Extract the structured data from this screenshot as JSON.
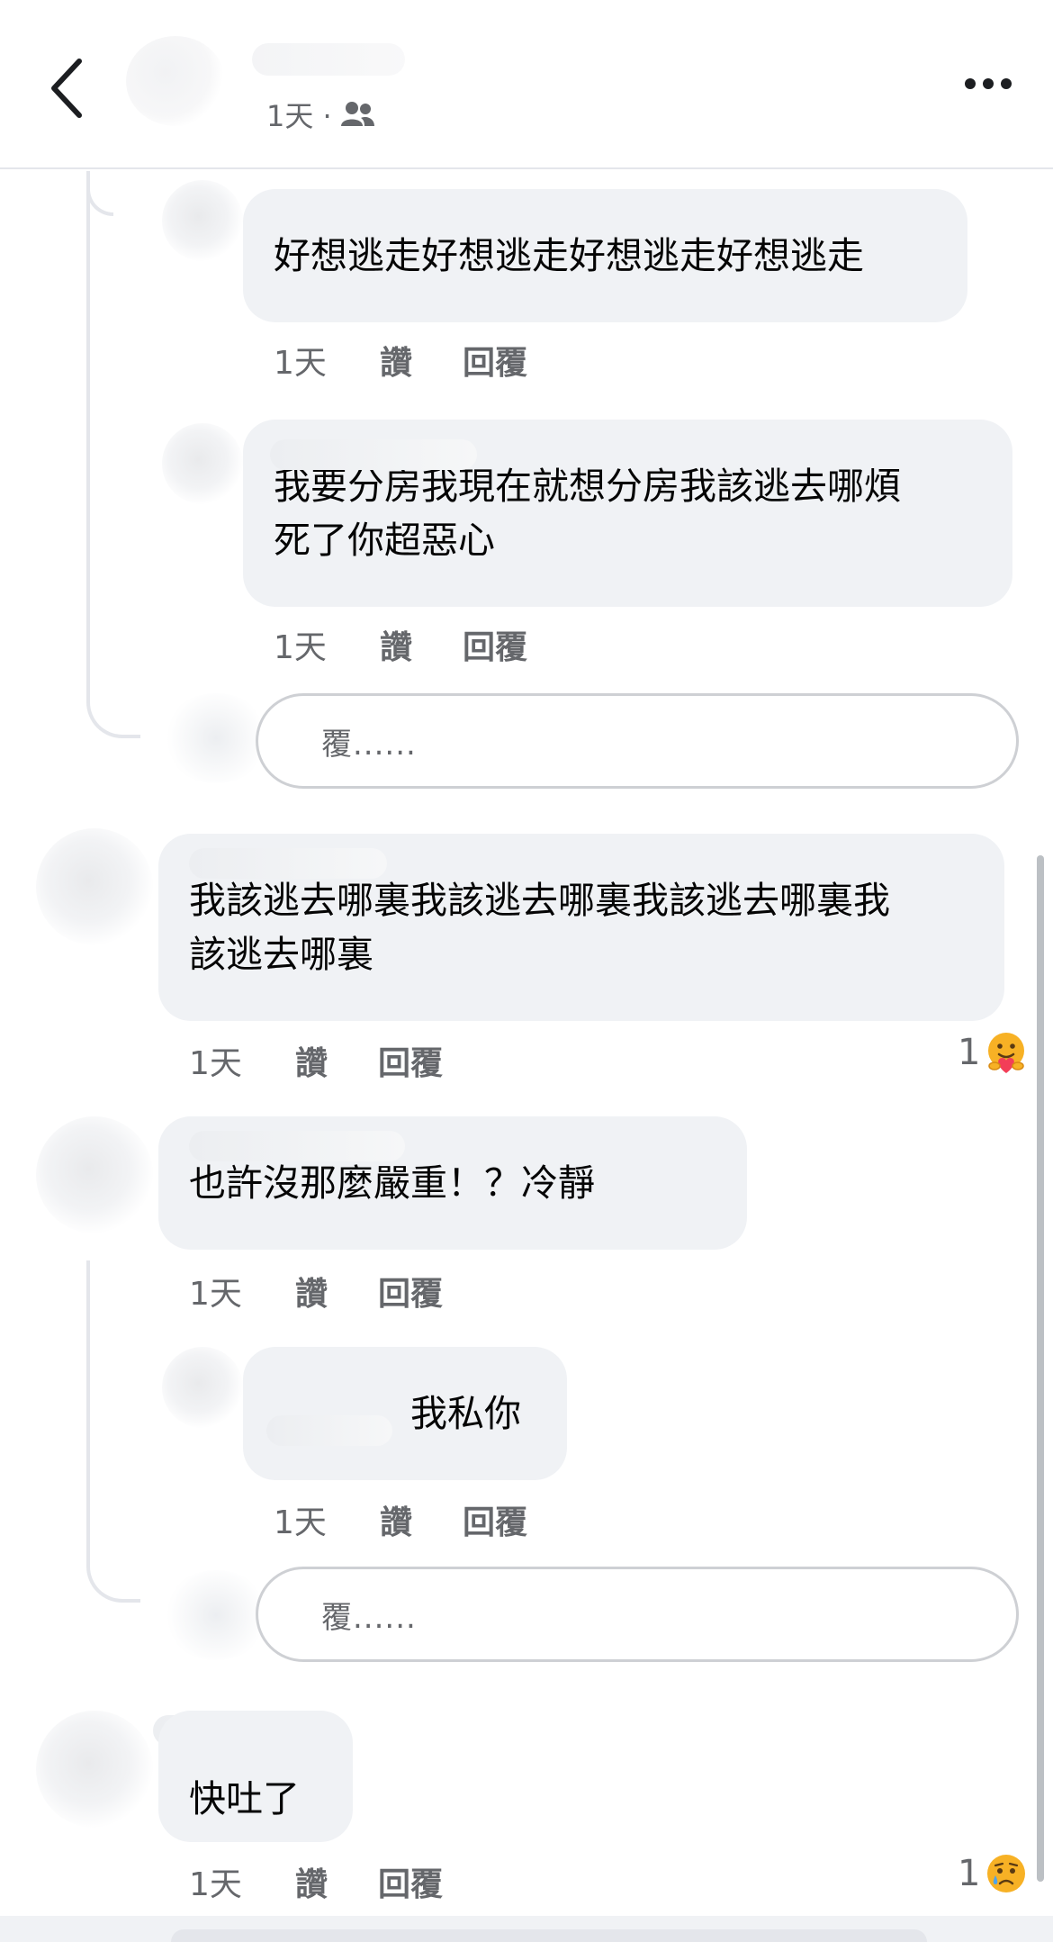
{
  "header": {
    "meta_time": "1天 ·",
    "friends_icon": "friends-icon",
    "back_icon": "chevron-left-icon",
    "more_icon": "more-dots-icon"
  },
  "comments": [
    {
      "text": "好想逃走好想逃走好想逃走好想逃走",
      "time": "1天",
      "like": "讚",
      "reply": "回覆"
    },
    {
      "text": "我要分房我現在就想分房我該逃去哪煩\n死了你超惡心",
      "time": "1天",
      "like": "讚",
      "reply": "回覆"
    },
    {
      "text": "我該逃去哪裏我該逃去哪裏我該逃去哪裏我\n該逃去哪裏",
      "time": "1天",
      "like": "讚",
      "reply": "回覆",
      "reaction_count": "1",
      "reaction_icon": "care-emoji-icon"
    },
    {
      "text": "也許沒那麼嚴重！？冷靜",
      "time": "1天",
      "like": "讚",
      "reply": "回覆"
    },
    {
      "text": "我私你",
      "time": "1天",
      "like": "讚",
      "reply": "回覆"
    },
    {
      "text": "快吐了",
      "time": "1天",
      "like": "讚",
      "reply": "回覆",
      "reaction_count": "1",
      "reaction_icon": "sad-emoji-icon"
    }
  ],
  "reply_boxes": [
    {
      "placeholder": "覆......"
    },
    {
      "placeholder": "覆......"
    }
  ],
  "colors": {
    "bubble": "#f0f2f5",
    "secondary_text": "#65676b",
    "thread_line": "#e4e6eb"
  }
}
